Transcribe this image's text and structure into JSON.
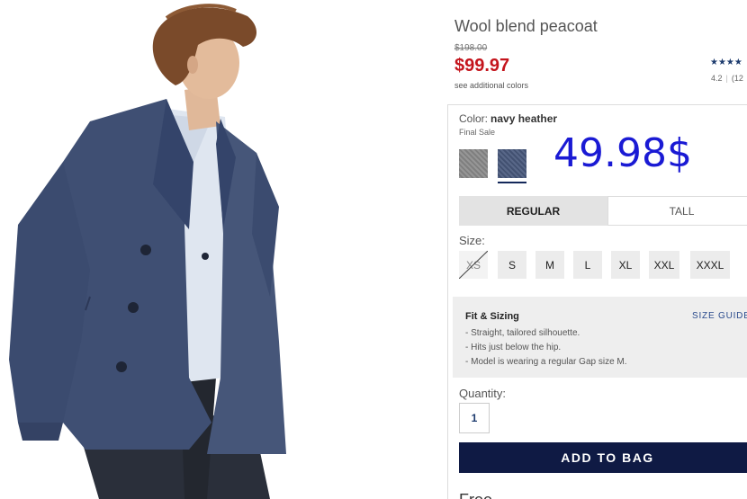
{
  "product": {
    "title": "Wool blend peacoat",
    "was_price": "$198.00",
    "sale_price": "$99.97",
    "see_colors": "see additional colors",
    "stars": "★★★★",
    "rating": "4.2",
    "rating_count": "(12"
  },
  "color": {
    "label": "Color:",
    "selected": "navy heather",
    "note": "Final Sale",
    "swatches": [
      {
        "name": "grey",
        "color": "#8a8a8a"
      },
      {
        "name": "navy heather",
        "color": "#4a5a7e",
        "selected": true
      }
    ]
  },
  "overlay_price": "49.98$",
  "fit_tabs": [
    {
      "label": "REGULAR",
      "active": true
    },
    {
      "label": "TALL",
      "active": false
    }
  ],
  "sizes": {
    "label": "Size:",
    "options": [
      {
        "label": "XS",
        "available": false
      },
      {
        "label": "S",
        "available": true
      },
      {
        "label": "M",
        "available": true
      },
      {
        "label": "L",
        "available": true
      },
      {
        "label": "XL",
        "available": true
      },
      {
        "label": "XXL",
        "available": true
      },
      {
        "label": "XXXL",
        "available": true
      }
    ]
  },
  "fit": {
    "title": "Fit & Sizing",
    "size_guide": "SIZE GUIDE",
    "bullets": [
      "- Straight, tailored silhouette.",
      "- Hits just below the hip.",
      "- Model is wearing a regular Gap size M."
    ]
  },
  "quantity": {
    "label": "Quantity:",
    "value": "1"
  },
  "add_to_bag": "ADD TO BAG",
  "cut_heading": "Free ... "
}
